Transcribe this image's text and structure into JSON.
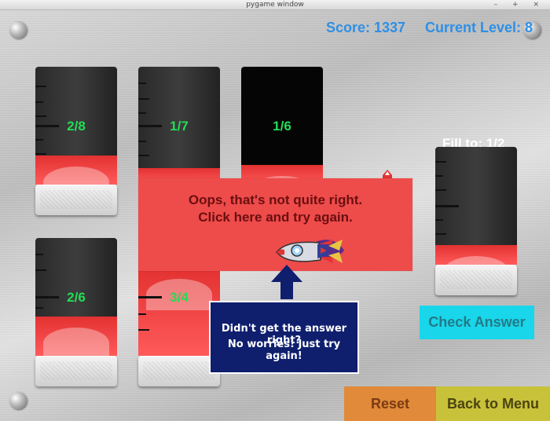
{
  "window": {
    "title": "pygame window",
    "controls": "– + ×"
  },
  "hud": {
    "score": "Score: 1337",
    "level": "Current Level: 8"
  },
  "tubes": [
    {
      "label": "2/8",
      "fill_fraction": 0.25
    },
    {
      "label": "1/7",
      "fill_fraction": 0.14
    },
    {
      "label": "1/6",
      "fill_fraction": 0.17
    },
    {
      "label": "2/6",
      "fill_fraction": 0.33
    },
    {
      "label": "3/4",
      "fill_fraction": 0.75
    }
  ],
  "target": {
    "label": "Fill to: 1/2",
    "fill_fraction": 0.17
  },
  "feedback": {
    "line1": "Oops, that's not quite right.",
    "line2": "Click here and try again."
  },
  "hint": {
    "line1": "Didn't get the answer right?",
    "line2": "No worries! Just try again!"
  },
  "buttons": {
    "check": "Check Answer",
    "reset": "Reset",
    "menu": "Back to Menu"
  },
  "colors": {
    "hud": "#2e8fe6",
    "fraction_text": "#22dd55",
    "liquid": "#e33131",
    "feedback_panel": "#ee4b4b",
    "hint_panel": "#0f1f6e",
    "check_button": "#19d6ea",
    "reset_button": "#e08a3a",
    "menu_button": "#c7c23a"
  }
}
